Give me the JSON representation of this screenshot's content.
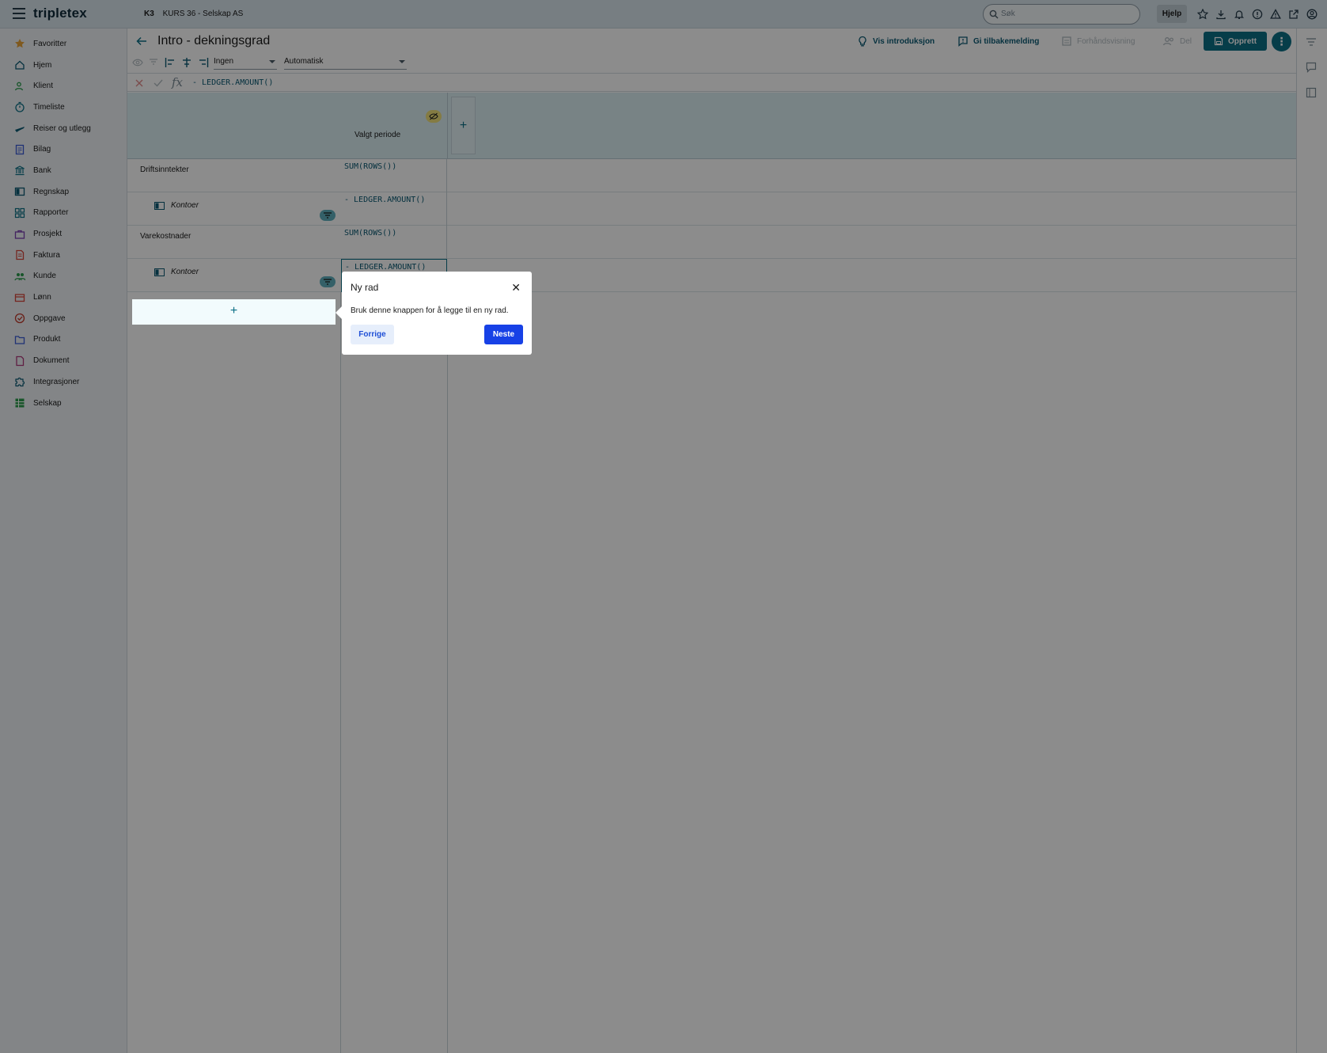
{
  "topbar": {
    "logo": "tripletex",
    "company_code": "K3",
    "company_name": "KURS 36 - Selskap AS",
    "search_placeholder": "Søk",
    "help_label": "Hjelp"
  },
  "sidebar": {
    "items": [
      {
        "label": "Favoritter",
        "icon": "star-icon"
      },
      {
        "label": "Hjem",
        "icon": "home-icon"
      },
      {
        "label": "Klient",
        "icon": "client-icon"
      },
      {
        "label": "Timeliste",
        "icon": "stopwatch-icon"
      },
      {
        "label": "Reiser og utlegg",
        "icon": "plane-icon"
      },
      {
        "label": "Bilag",
        "icon": "voucher-icon"
      },
      {
        "label": "Bank",
        "icon": "bank-icon"
      },
      {
        "label": "Regnskap",
        "icon": "book-icon"
      },
      {
        "label": "Rapporter",
        "icon": "dashboard-icon"
      },
      {
        "label": "Prosjekt",
        "icon": "briefcase-icon"
      },
      {
        "label": "Faktura",
        "icon": "invoice-icon"
      },
      {
        "label": "Kunde",
        "icon": "people-icon"
      },
      {
        "label": "Lønn",
        "icon": "wallet-icon"
      },
      {
        "label": "Oppgave",
        "icon": "check-circle-icon"
      },
      {
        "label": "Produkt",
        "icon": "folder-icon"
      },
      {
        "label": "Dokument",
        "icon": "document-icon"
      },
      {
        "label": "Integrasjoner",
        "icon": "puzzle-icon"
      },
      {
        "label": "Selskap",
        "icon": "spreadsheet-icon"
      }
    ]
  },
  "header": {
    "title": "Intro - dekningsgrad",
    "vis_introduksjon": "Vis introduksjon",
    "gi_tilbakemelding": "Gi tilbakemelding",
    "forhandsvisning": "Forhåndsvisning",
    "del": "Del",
    "opprett": "Opprett"
  },
  "toolbar": {
    "select_1": "Ingen",
    "select_2": "Automatisk"
  },
  "formula": {
    "value": "- LEDGER.AMOUNT()"
  },
  "grid": {
    "column_header": "Valgt periode",
    "rows": [
      {
        "label": "Driftsinntekter",
        "formula": "SUM(ROWS())"
      },
      {
        "sub_label": "Kontoer",
        "formula": "- LEDGER.AMOUNT()"
      },
      {
        "label": "Varekostnader",
        "formula": "SUM(ROWS())"
      },
      {
        "sub_label": "Kontoer",
        "formula": "- LEDGER.AMOUNT()"
      }
    ],
    "add_row": "+",
    "add_column": "+"
  },
  "popover": {
    "title": "Ny rad",
    "close": "✕",
    "body": "Bruk denne knappen for å legge til en ny rad.",
    "prev": "Forrige",
    "next": "Neste"
  },
  "colors": {
    "brand": "#0b6f86",
    "primary_button": "#1741e6"
  }
}
